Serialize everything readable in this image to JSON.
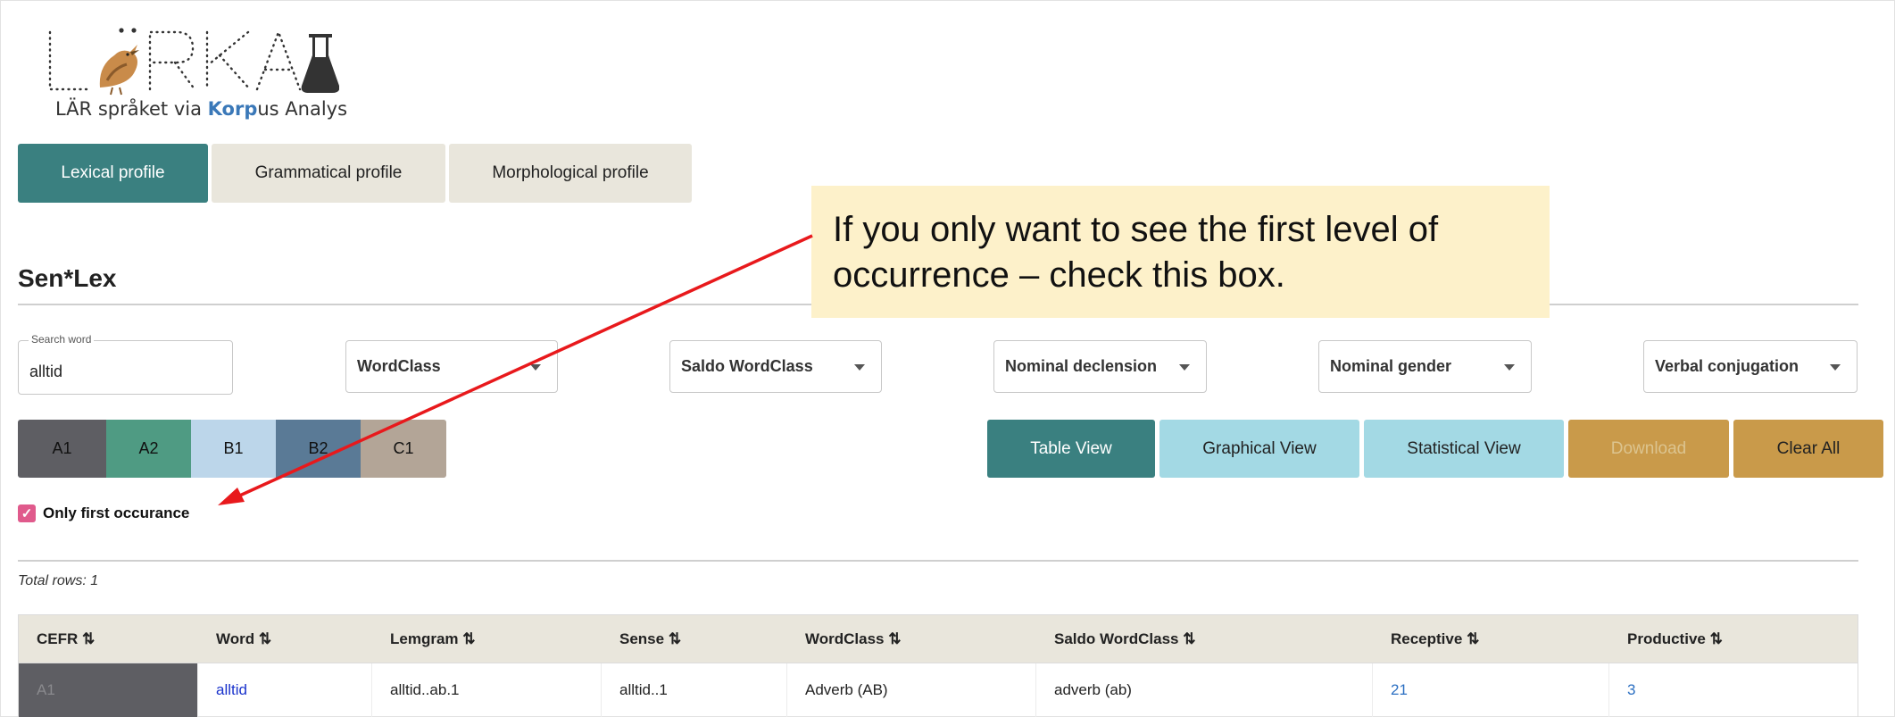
{
  "logo": {
    "letters": "LÄRKA",
    "tagline_prefix": "LÄR språket via ",
    "tagline_korp": "Korp",
    "tagline_suffix": "us Analys"
  },
  "tabs": [
    {
      "label": "Lexical profile",
      "active": true
    },
    {
      "label": "Grammatical profile",
      "active": false
    },
    {
      "label": "Morphological profile",
      "active": false
    }
  ],
  "heading": "Sen*Lex",
  "search": {
    "label": "Search word",
    "value": "alltid"
  },
  "filters": [
    {
      "label": "WordClass"
    },
    {
      "label": "Saldo WordClass"
    },
    {
      "label": "Nominal declension"
    },
    {
      "label": "Nominal gender"
    },
    {
      "label": "Verbal conjugation"
    }
  ],
  "levels": [
    {
      "label": "A1",
      "color": "#5e5e63"
    },
    {
      "label": "A2",
      "color": "#4f9b83"
    },
    {
      "label": "B1",
      "color": "#bcd6ea"
    },
    {
      "label": "B2",
      "color": "#5a7a96"
    },
    {
      "label": "C1",
      "color": "#b3a597"
    }
  ],
  "views": [
    {
      "label": "Table View",
      "bg": "#3a8080",
      "fg": "#ffffff"
    },
    {
      "label": "Graphical View",
      "bg": "#a3d9e4",
      "fg": "#222222"
    },
    {
      "label": "Statistical View",
      "bg": "#a3d9e4",
      "fg": "#222222"
    },
    {
      "label": "Download",
      "bg": "#c99a4a",
      "fg": "#dcc48f"
    },
    {
      "label": "Clear All",
      "bg": "#c99a4a",
      "fg": "#222222"
    }
  ],
  "only_first": {
    "label": "Only first occurance",
    "checked": true
  },
  "total_rows": "Total rows: 1",
  "table": {
    "columns": [
      "CEFR",
      "Word",
      "Lemgram",
      "Sense",
      "WordClass",
      "Saldo WordClass",
      "Receptive",
      "Productive"
    ],
    "sort_glyph": "⇅",
    "rows": [
      {
        "cefr": "A1",
        "word": "alltid",
        "lemgram": "alltid..ab.1",
        "sense": "alltid..1",
        "wordclass": "Adverb (AB)",
        "saldo": "adverb (ab)",
        "receptive": "21",
        "productive": "3"
      }
    ]
  },
  "callout": {
    "text": "If you only want to see the first level of occurrence – check this box."
  },
  "colors": {
    "accent": "#3a8080",
    "arrow": "#e8191c",
    "callout_bg": "#fdf1ca"
  }
}
